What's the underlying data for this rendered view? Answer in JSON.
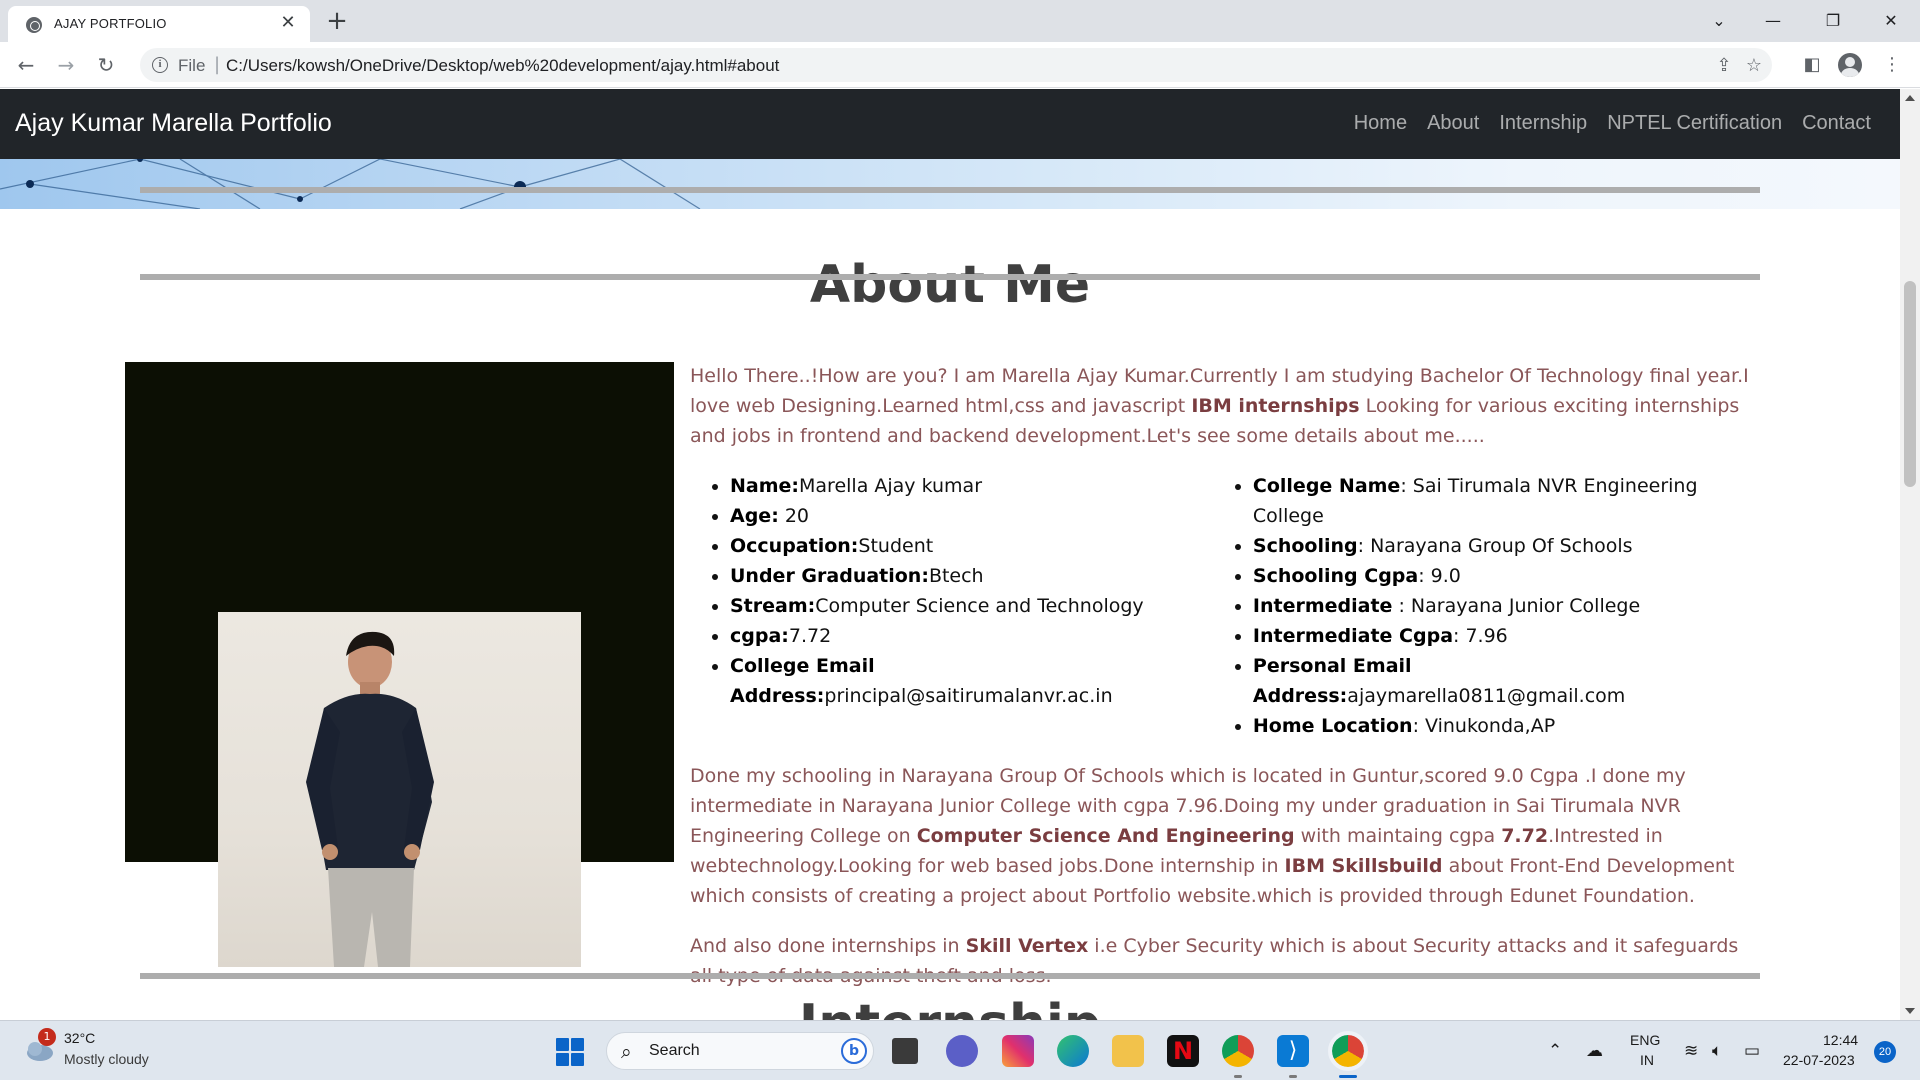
{
  "browser": {
    "tab_title": "AJAY PORTFOLIO",
    "url_scheme_label": "File",
    "url": "C:/Users/kowsh/OneDrive/Desktop/web%20development/ajay.html#about"
  },
  "site": {
    "brand": "Ajay Kumar Marella Portfolio",
    "nav": [
      "Home",
      "About",
      "Internship",
      "NPTEL Certification",
      "Contact"
    ]
  },
  "about": {
    "heading": "About Me",
    "intro_before": "Hello There..!How are you? I am Marella Ajay Kumar.Currently I am studying Bachelor Of Technology final year.I love web Designing.Learned html,css and javascript ",
    "intro_bold": "IBM internships",
    "intro_after": " Looking for various exciting internships and jobs in frontend and backend development.Let's see some details about me.....",
    "details_left": [
      {
        "label": "Name:",
        "value": "Marella Ajay kumar"
      },
      {
        "label": "Age:",
        "value": " 20"
      },
      {
        "label": "Occupation:",
        "value": "Student"
      },
      {
        "label": "Under Graduation:",
        "value": "Btech"
      },
      {
        "label": "Stream:",
        "value": "Computer Science and Technology"
      },
      {
        "label": "cgpa:",
        "value": "7.72"
      },
      {
        "label": "College Email Address:",
        "value": "principal@saitirumalanvr.ac.in"
      }
    ],
    "details_right": [
      {
        "label": "College Name",
        "value": ": Sai Tirumala NVR Engineering College"
      },
      {
        "label": "Schooling",
        "value": ": Narayana Group Of Schools"
      },
      {
        "label": "Schooling Cgpa",
        "value": ": 9.0"
      },
      {
        "label": "Intermediate",
        "value": " : Narayana Junior College"
      },
      {
        "label": "Intermediate Cgpa",
        "value": ": 7.96"
      },
      {
        "label": "Personal Email Address:",
        "value": "ajaymarella0811@gmail.com"
      },
      {
        "label": "Home Location",
        "value": ": Vinukonda,AP"
      }
    ],
    "para2": [
      {
        "t": "Done my schooling in Narayana Group Of Schools which is located in Guntur,scored 9.0 Cgpa .I done my intermediate in Narayana Junior College with cgpa 7.96.Doing my under graduation in Sai Tirumala NVR Engineering College on ",
        "b": false
      },
      {
        "t": "Computer Science And Engineering",
        "b": true
      },
      {
        "t": " with maintaing cgpa ",
        "b": false
      },
      {
        "t": "7.72",
        "b": true
      },
      {
        "t": ".Intrested in webtechnology.Looking for web based jobs.Done internship in ",
        "b": false
      },
      {
        "t": "IBM Skillsbuild",
        "b": true
      },
      {
        "t": " about Front-End Development which consists of creating a project about Portfolio website.which is provided through Edunet Foundation.",
        "b": false
      }
    ],
    "para3": [
      {
        "t": "And also done internships in ",
        "b": false
      },
      {
        "t": "Skill Vertex",
        "b": true
      },
      {
        "t": " i.e Cyber Security which is about Security attacks and it safeguards all type of data against theft and loss.",
        "b": false
      }
    ],
    "next_heading": "Internship"
  },
  "taskbar": {
    "weather_badge": "1",
    "temperature": "32°C",
    "weather": "Mostly cloudy",
    "search_label": "Search",
    "lang_top": "ENG",
    "lang_bottom": "IN",
    "time": "12:44",
    "date": "22-07-2023",
    "notification_count": "20"
  },
  "colors": {
    "navbar_bg": "#212529",
    "para_text": "#8a5658",
    "photo_backdrop": "#0c0f04"
  }
}
